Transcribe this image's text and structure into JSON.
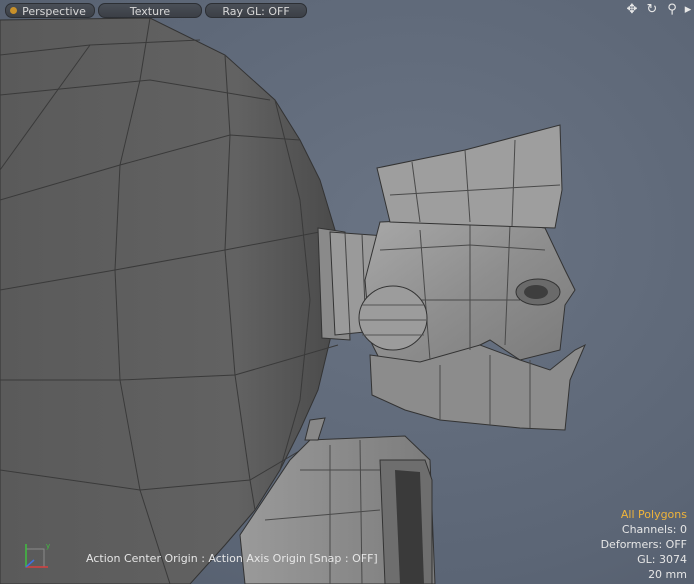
{
  "toolbar": {
    "view_label": "Perspective",
    "shading_label": "Texture",
    "raygl_label": "Ray GL: OFF"
  },
  "tools": [
    {
      "icon": "move-icon",
      "glyph": "✥"
    },
    {
      "icon": "rotate-icon",
      "glyph": "↻"
    },
    {
      "icon": "zoom-icon",
      "glyph": "⚲"
    },
    {
      "icon": "expand-arrow-icon",
      "glyph": "▸"
    }
  ],
  "status": {
    "action_center": "Action Center Origin : Action Axis Origin  [Snap : OFF]"
  },
  "info": {
    "selection_mode": "All Polygons",
    "channels": "Channels: 0",
    "deformers": "Deformers: OFF",
    "gl": "GL: 3074",
    "scale": "20 mm"
  },
  "colors": {
    "accent": "#f0b43a",
    "viewport_bg": "#5e6878"
  }
}
